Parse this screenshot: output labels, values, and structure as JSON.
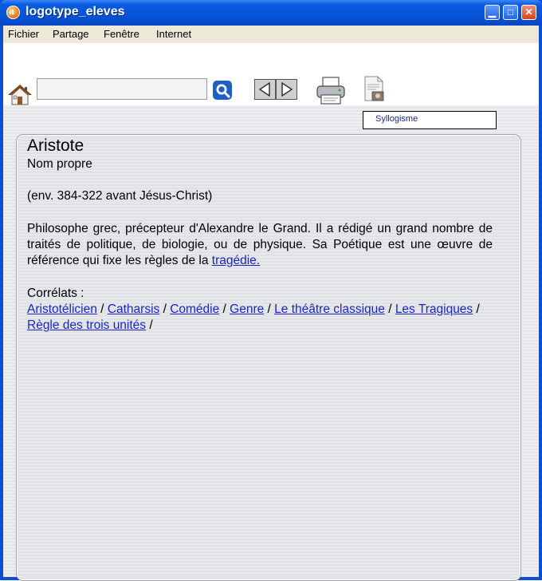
{
  "window": {
    "title": "logotype_eleves",
    "minimize_glyph": "▁",
    "maximize_glyph": "□",
    "close_glyph": "✕"
  },
  "menu": [
    "Fichier",
    "Partage",
    "Fenêtre",
    "Internet"
  ],
  "toolbar": {
    "search_value": "",
    "icons": [
      "home-icon",
      "search-icon",
      "back-arrow-icon",
      "forward-arrow-icon",
      "printer-icon",
      "document-icon"
    ]
  },
  "tooltip": "Syllogisme",
  "entry": {
    "title": "Aristote",
    "category": "Nom propre",
    "dates": "(env. 384-322 avant Jésus-Christ)",
    "description": "Philosophe grec, précepteur d'Alexandre le Grand. Il a rédigé un grand nombre de traités de politique, de biologie, ou de physique. Sa Poétique est une œuvre de référence qui fixe les règles de la ",
    "description_link": "tragédie.",
    "correlats_label": "Corrélats :",
    "correlats": [
      "Aristotélicien",
      "Catharsis",
      "Comédie",
      "Genre",
      "Le théâtre classique",
      "Les Tragiques",
      "Règle des trois unités"
    ],
    "separator": " / "
  },
  "colors": {
    "link": "#1a25c8",
    "titlebar": "#0554d8",
    "menubar": "#ece9d8"
  }
}
